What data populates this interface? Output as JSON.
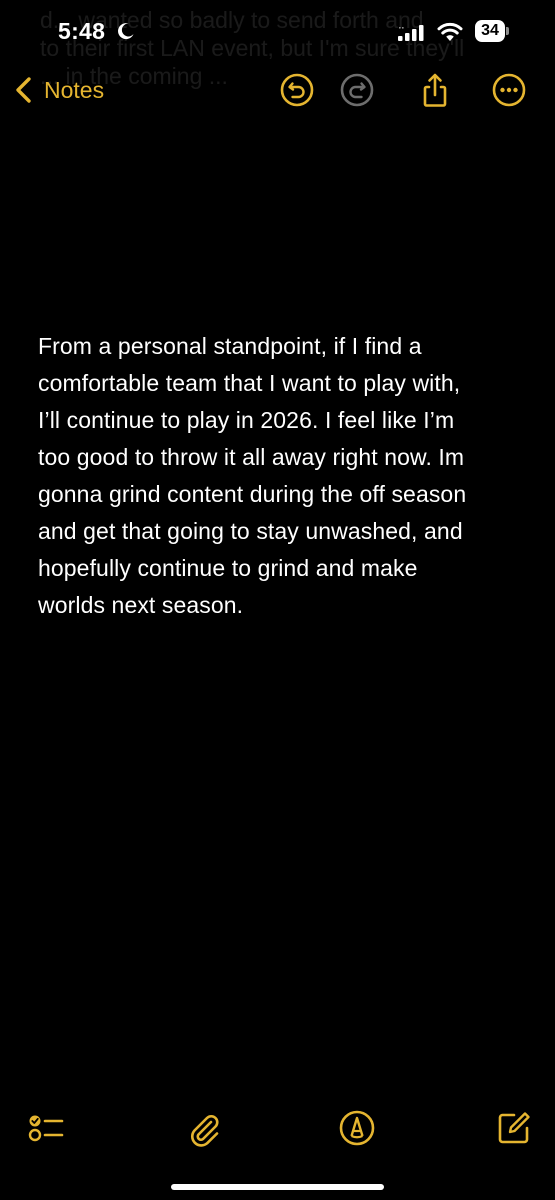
{
  "status_bar": {
    "time": "5:48",
    "battery_level": "34",
    "moon_icon": "moon-icon",
    "signal_icon": "cellular-signal-icon",
    "wifi_icon": "wifi-icon"
  },
  "nav": {
    "back_label": "Notes",
    "undo_icon": "undo-icon",
    "redo_icon": "redo-icon",
    "share_icon": "share-icon",
    "more_icon": "more-icon"
  },
  "ghost_text": [
    "d... wanted so badly to send forth and",
    "to their first LAN event, but I'm sure they'll",
    "... in the coming ..."
  ],
  "note": {
    "lines": [
      "From a personal standpoint, if I find a",
      "comfortable team that I want to play with,",
      "I’ll continue to play in 2026. I feel like I’m",
      "too good to throw it all away right now. Im",
      "gonna grind content during the off season",
      "and get that going to stay unwashed, and",
      "hopefully continue to grind and make",
      "worlds next season."
    ]
  },
  "toolbar": {
    "checklist_icon": "checklist-icon",
    "attachment_icon": "paperclip-icon",
    "markup_icon": "markup-pen-icon",
    "compose_icon": "compose-icon"
  },
  "colors": {
    "accent": "#e5b530",
    "background": "#000000",
    "text": "#ffffff"
  }
}
